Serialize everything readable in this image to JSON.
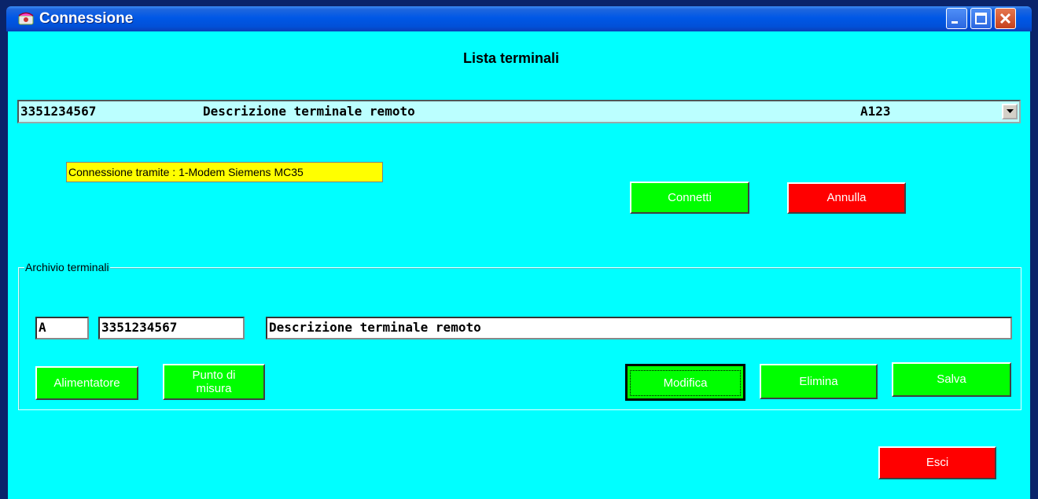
{
  "window": {
    "title": "Connessione"
  },
  "main": {
    "heading": "Lista terminali",
    "terminal_combo": {
      "number": "3351234567",
      "description": "Descrizione terminale remoto",
      "code": "A123"
    },
    "connection_label": "Connessione tramite : 1-Modem Siemens MC35",
    "connect_button": "Connetti",
    "cancel_button": "Annulla"
  },
  "archive": {
    "legend": "Archivio terminali",
    "field_letter": "A",
    "field_number": "3351234567",
    "field_description": "Descrizione terminale remoto",
    "power_button": "Alimentatore",
    "measure_button_line1": "Punto di",
    "measure_button_line2": "misura",
    "edit_button": "Modifica",
    "delete_button": "Elimina",
    "save_button": "Salva"
  },
  "exit_button": "Esci",
  "colors": {
    "background": "#00ffff",
    "button_green": "#00ff00",
    "button_red": "#ff0000",
    "label_yellow": "#ffff00"
  },
  "icons": {
    "title": "phone-icon",
    "minimize": "minimize-icon",
    "maximize": "maximize-icon",
    "close": "close-icon",
    "dropdown": "chevron-down-icon"
  }
}
